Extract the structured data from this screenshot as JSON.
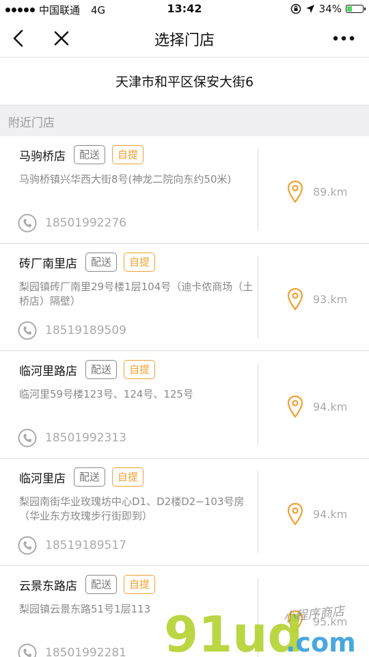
{
  "status_bar": {
    "carrier": "中国联通",
    "network": "4G",
    "time": "13:42",
    "battery": "34%",
    "battery_level": 0.34
  },
  "nav": {
    "title": "选择门店"
  },
  "address": "天津市和平区保安大街6",
  "section_label": "附近门店",
  "tags": {
    "delivery": "配送",
    "pickup": "自提"
  },
  "stores": [
    {
      "name": "马驹桥店",
      "address": "马驹桥镇兴华西大街8号(神龙二院向东约50米)",
      "phone": "18501992276",
      "distance": "89.km"
    },
    {
      "name": "砖厂南里店",
      "address": "梨园镇砖厂南里29号楼1层104号（迪卡侬商场（土桥店）隔壁）",
      "phone": "18519189509",
      "distance": "93.km"
    },
    {
      "name": "临河里路店",
      "address": "临河里59号楼123号、124号、125号",
      "phone": "18501992313",
      "distance": "94.km"
    },
    {
      "name": "临河里店",
      "address": "梨园南街华业玫瑰坊中心D1、D2楼D2−103号房（华业东方玫瑰步行街即到）",
      "phone": "18519189517",
      "distance": "94.km"
    },
    {
      "name": "云景东路店",
      "address": "梨园镇云景东路51号1层113",
      "phone": "18501992281",
      "distance": "95.km"
    }
  ],
  "watermark": {
    "brand": "91ud",
    "suffix": ".com",
    "tagline": "小程序商店"
  },
  "colors": {
    "accent": "#f0a030",
    "watermark_green": "#b5d334",
    "watermark_blue": "#3aa0dc"
  }
}
